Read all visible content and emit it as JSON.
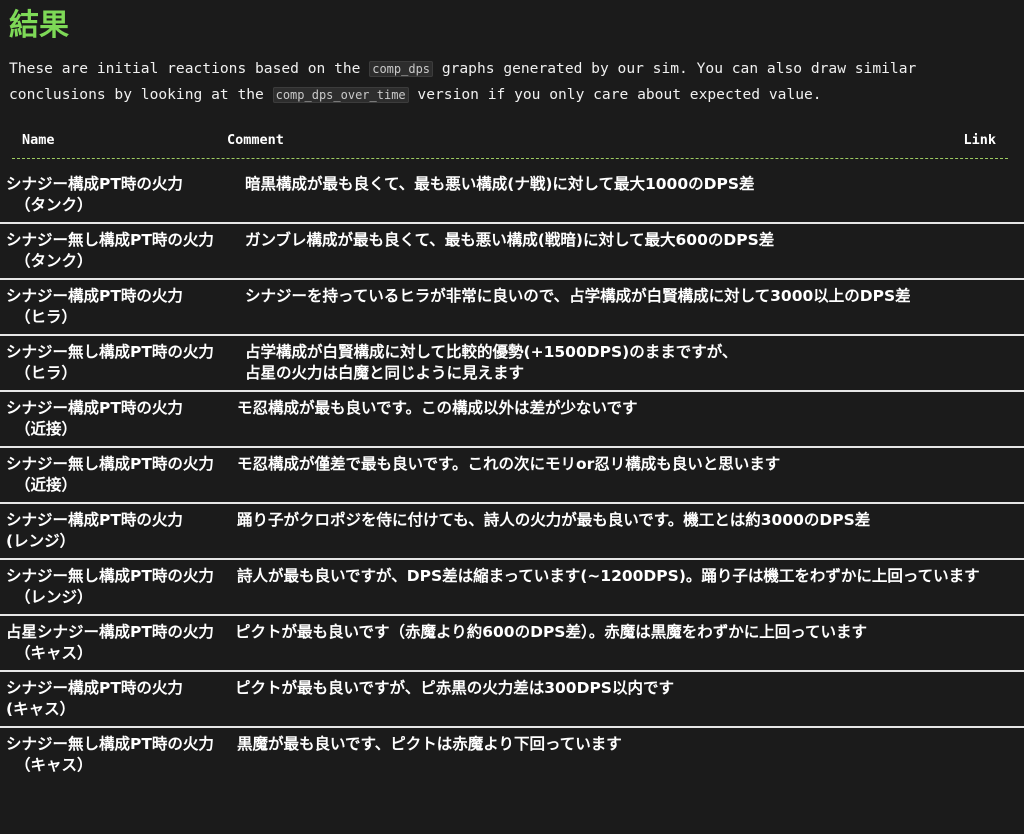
{
  "title": "結果",
  "intro": {
    "p1": "These are initial reactions based on the ",
    "code1": "comp_dps",
    "p2": " graphs generated by our sim. You can also draw similar",
    "p3": "conclusions by looking at the ",
    "code2": "comp_dps_over_time",
    "p4": " version if you only care about expected value."
  },
  "table": {
    "headers": {
      "name": "Name",
      "comment": "Comment",
      "link": "Link"
    },
    "rows": [
      {
        "name1": "シナジー構成PT時の火力",
        "name2": "（タンク）",
        "comment1": "暗黒構成が最も良くて、最も悪い構成(ナ戦)に対して最大1000のDPS差",
        "comment2": ""
      },
      {
        "name1": "シナジー無し構成PT時の火力",
        "name2": "（タンク）",
        "comment1": "ガンブレ構成が最も良くて、最も悪い構成(戦暗)に対して最大600のDPS差",
        "comment2": ""
      },
      {
        "name1": "シナジー構成PT時の火力",
        "name2": "（ヒラ）",
        "comment1": "シナジーを持っているヒラが非常に良いので、占学構成が白賢構成に対して3000以上のDPS差",
        "comment2": ""
      },
      {
        "name1": "シナジー無し構成PT時の火力",
        "name2": "（ヒラ）",
        "comment1": "占学構成が白賢構成に対して比較的優勢(+1500DPS)のままですが、",
        "comment2": "占星の火力は白魔と同じように見えます"
      },
      {
        "name1": "シナジー構成PT時の火力",
        "name2": "（近接）",
        "comment1": "モ忍構成が最も良いです。この構成以外は差が少ないです",
        "comment2": ""
      },
      {
        "name1": "シナジー無し構成PT時の火力",
        "name2": "（近接）",
        "comment1": "モ忍構成が僅差で最も良いです。これの次にモリor忍リ構成も良いと思います",
        "comment2": ""
      },
      {
        "name1": "シナジー構成PT時の火力",
        "name2": "(レンジ）",
        "comment1": "踊り子がクロポジを侍に付けても、詩人の火力が最も良いです。機工とは約3000のDPS差",
        "comment2": ""
      },
      {
        "name1": "シナジー無し構成PT時の火力",
        "name2": "（レンジ）",
        "comment1": "詩人が最も良いですが、DPS差は縮まっています(~1200DPS)。踊り子は機工をわずかに上回っています",
        "comment2": ""
      },
      {
        "name1": "占星シナジー構成PT時の火力",
        "name2": "（キャス）",
        "comment1": "ピクトが最も良いです（赤魔より約600のDPS差）。赤魔は黒魔をわずかに上回っています",
        "comment2": ""
      },
      {
        "name1": "シナジー構成PT時の火力",
        "name2": "(キャス）",
        "comment1": "ピクトが最も良いですが、ピ赤黒の火力差は300DPS以内です",
        "comment2": ""
      },
      {
        "name1": "シナジー無し構成PT時の火力",
        "name2": "（キャス）",
        "comment1": "黒魔が最も良いです、ピクトは赤魔より下回っています",
        "comment2": ""
      }
    ]
  }
}
